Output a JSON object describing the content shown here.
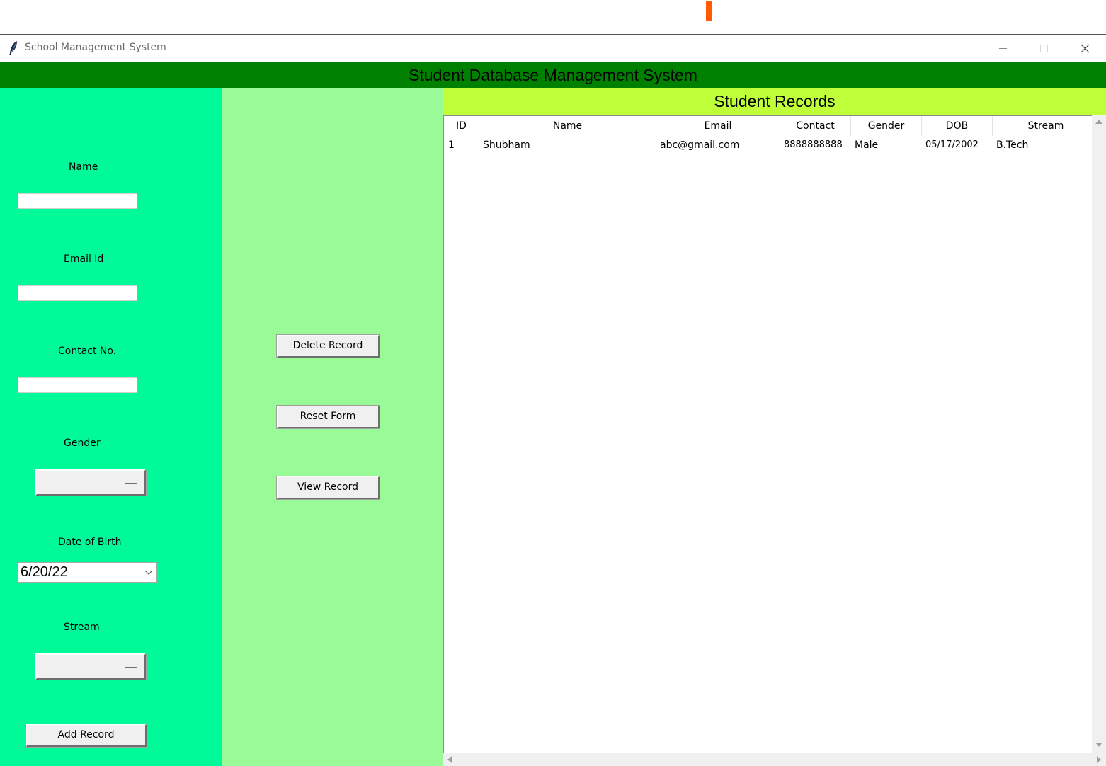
{
  "window": {
    "title": "School Management System",
    "icon": "feather-icon",
    "controls": [
      "minimize-icon",
      "maximize-icon",
      "close-icon"
    ]
  },
  "app_header": "Student Database Management System",
  "form": {
    "name_label": "Name",
    "name_value": "",
    "email_label": "Email Id",
    "email_value": "",
    "contact_label": "Contact No.",
    "contact_value": "",
    "gender_label": "Gender",
    "gender_value": "",
    "dob_label": "Date of Birth",
    "dob_value": "6/20/22",
    "stream_label": "Stream",
    "stream_value": "",
    "add_button": "Add Record"
  },
  "actions": {
    "delete_button": "Delete Record",
    "reset_button": "Reset Form",
    "view_button": "View Record"
  },
  "records": {
    "title": "Student Records",
    "columns": [
      "ID",
      "Name",
      "Email",
      "Contact",
      "Gender",
      "DOB",
      "Stream"
    ],
    "rows": [
      [
        "1",
        "Shubham",
        "abc@gmail.com",
        "8888888888",
        "Male",
        "05/17/2002",
        "B.Tech"
      ]
    ]
  },
  "colors": {
    "header_bg": "#008000",
    "left_panel_bg": "#00fa9a",
    "middle_panel_bg": "#98fb98",
    "records_header_bg": "#bfff3a"
  }
}
